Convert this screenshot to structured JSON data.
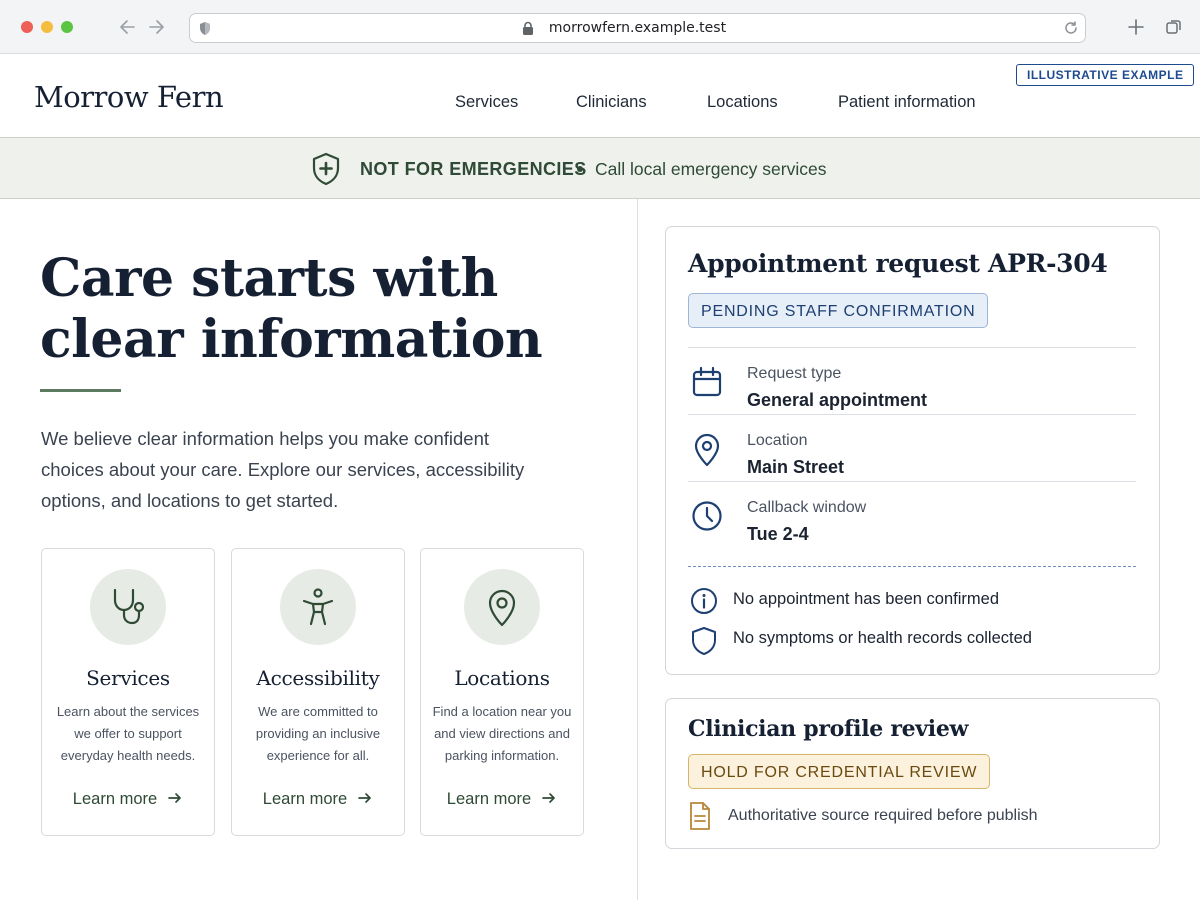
{
  "browser": {
    "url": "morrowfern.example.test"
  },
  "header": {
    "brand": "Morrow Fern",
    "nav": [
      "Services",
      "Clinicians",
      "Locations",
      "Patient information"
    ],
    "badge": "ILLUSTRATIVE EXAMPLE"
  },
  "banner": {
    "title": "NOT FOR EMERGENCIES",
    "text": "Call local emergency services"
  },
  "hero": {
    "title_line1": "Care starts with",
    "title_line2": "clear information",
    "body": "We believe clear information helps you make confident choices about your care. Explore our services, accessibility options, and locations to get started."
  },
  "cards": [
    {
      "icon": "stethoscope-icon",
      "title": "Services",
      "body": "Learn about the services we offer to support everyday health needs.",
      "link": "Learn more"
    },
    {
      "icon": "accessibility-icon",
      "title": "Accessibility",
      "body": "We are committed to providing an inclusive experience for all.",
      "link": "Learn more"
    },
    {
      "icon": "map-pin-icon",
      "title": "Locations",
      "body": "Find a location near you and view directions and parking information.",
      "link": "Learn more"
    }
  ],
  "appointment": {
    "title": "Appointment request APR-304",
    "status": "PENDING STAFF CONFIRMATION",
    "rows": [
      {
        "icon": "calendar-icon",
        "label": "Request type",
        "value": "General appointment"
      },
      {
        "icon": "location-icon",
        "label": "Location",
        "value": "Main Street"
      },
      {
        "icon": "clock-icon",
        "label": "Callback window",
        "value": "Tue 2-4"
      }
    ],
    "notes": [
      {
        "icon": "info-icon",
        "text": "No appointment has been confirmed"
      },
      {
        "icon": "shield-icon",
        "text": "No symptoms or health records collected"
      }
    ]
  },
  "clinician_review": {
    "title": "Clinician profile review",
    "status": "HOLD FOR CREDENTIAL REVIEW",
    "note": "Authoritative source required before publish"
  },
  "colors": {
    "brand_navy": "#152033",
    "forest_green": "#2f4a35",
    "banner_bg": "#eef1ec",
    "status_blue": "#1e3f72",
    "status_amber": "#6b4a0f"
  }
}
